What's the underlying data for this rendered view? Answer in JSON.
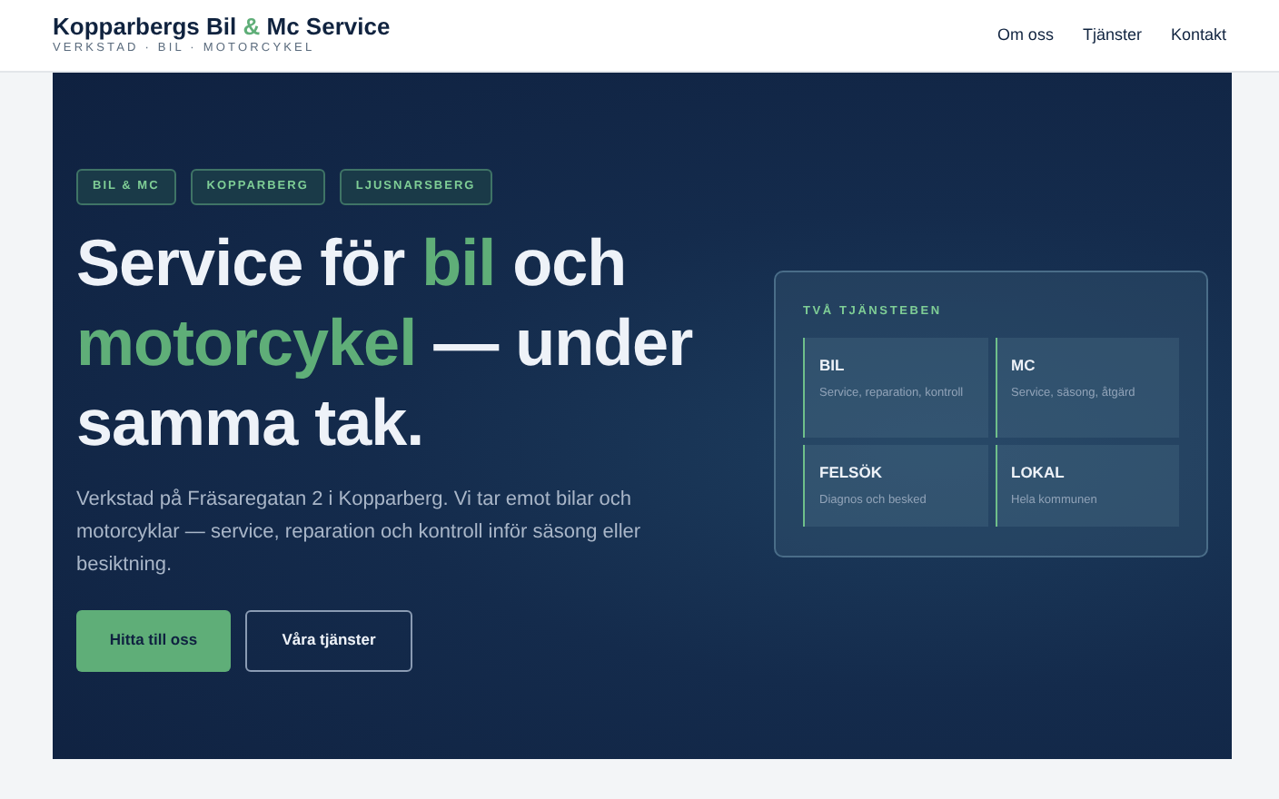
{
  "brand": {
    "parts": [
      {
        "text": "Kopparbergs Bil ",
        "accent": false
      },
      {
        "text": "&",
        "accent": true
      },
      {
        "text": " Mc Service",
        "accent": false
      }
    ],
    "tagline": "VERKSTAD · BIL · MOTORCYKEL"
  },
  "nav": [
    {
      "label": "Om oss"
    },
    {
      "label": "Tjänster"
    },
    {
      "label": "Kontakt"
    }
  ],
  "hero": {
    "tags": [
      "BIL & MC",
      "KOPPARBERG",
      "LJUSNARSBERG"
    ],
    "headline": [
      {
        "text": "Service för ",
        "accent": false
      },
      {
        "text": "bil",
        "accent": true
      },
      {
        "text": " och ",
        "accent": false
      },
      {
        "text": "motorcykel",
        "accent": true
      },
      {
        "text": " — under samma tak.",
        "accent": false
      }
    ],
    "lead": "Verkstad på Fräsaregatan 2 i Kopparberg. Vi tar emot bilar och motorcyklar — service, reparation och kontroll inför säsong eller besiktning.",
    "buttons": [
      {
        "label": "Hitta till oss",
        "kind": "primary"
      },
      {
        "label": "Våra tjänster",
        "kind": "outline"
      }
    ],
    "panel": {
      "title": "TVÅ TJÄNSTEBEN",
      "items": [
        {
          "title": "BIL",
          "text": "Service, reparation, kontroll"
        },
        {
          "title": "MC",
          "text": "Service, säsong, åtgärd"
        },
        {
          "title": "FELSÖK",
          "text": "Diagnos och besked"
        },
        {
          "title": "LOKAL",
          "text": "Hela kommunen"
        }
      ]
    }
  }
}
